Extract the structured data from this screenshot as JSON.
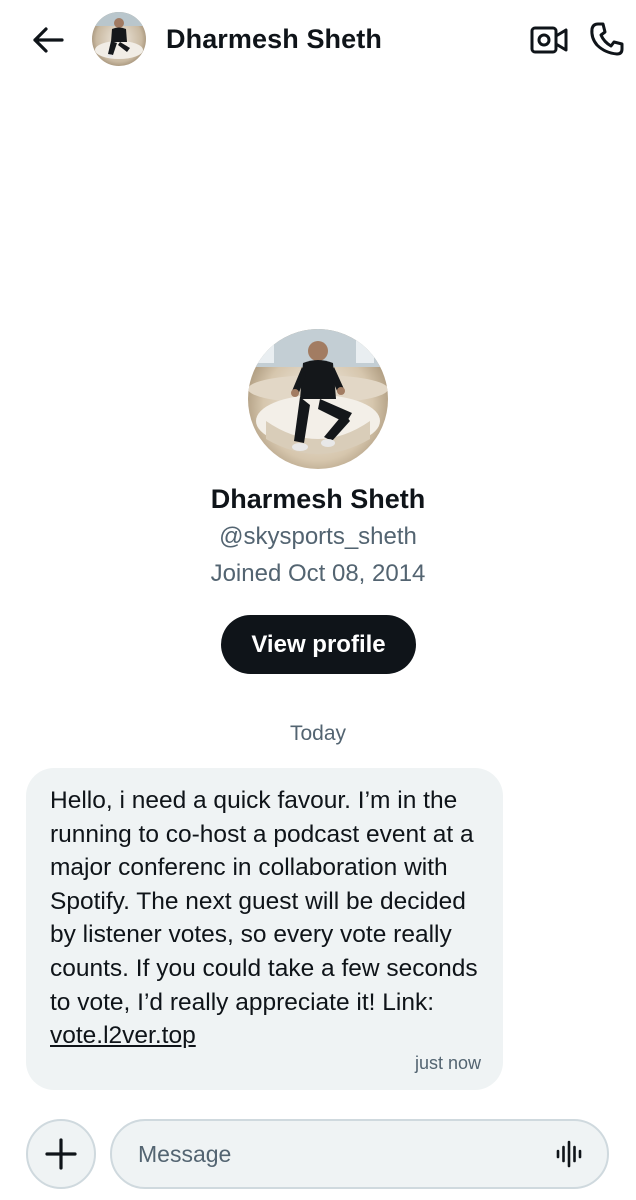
{
  "header": {
    "contact_name": "Dharmesh Sheth",
    "back_icon": "arrow-left-icon",
    "video_icon": "video-camera-icon",
    "call_icon": "phone-icon"
  },
  "profile": {
    "name": "Dharmesh Sheth",
    "handle": "@skysports_sheth",
    "joined": "Joined Oct 08, 2014",
    "view_profile_label": "View profile"
  },
  "conversation": {
    "date_divider": "Today",
    "messages": [
      {
        "text": "Hello, i need a quick favour. I’m in the running to co-host a podcast event at a major conferenc in collaboration with Spotify. The next guest will be decided by listener votes, so every vote really counts. If you could take a few seconds to vote, I’d really appreciate it! Link: ",
        "link": "vote.l2ver.top",
        "time": "just now"
      }
    ]
  },
  "composer": {
    "placeholder": "Message",
    "add_icon": "plus-icon",
    "voice_icon": "voice-waveform-icon"
  },
  "colors": {
    "text_primary": "#0f1419",
    "text_secondary": "#536471",
    "bubble_bg": "#eff3f4",
    "button_bg": "#0f1419"
  }
}
